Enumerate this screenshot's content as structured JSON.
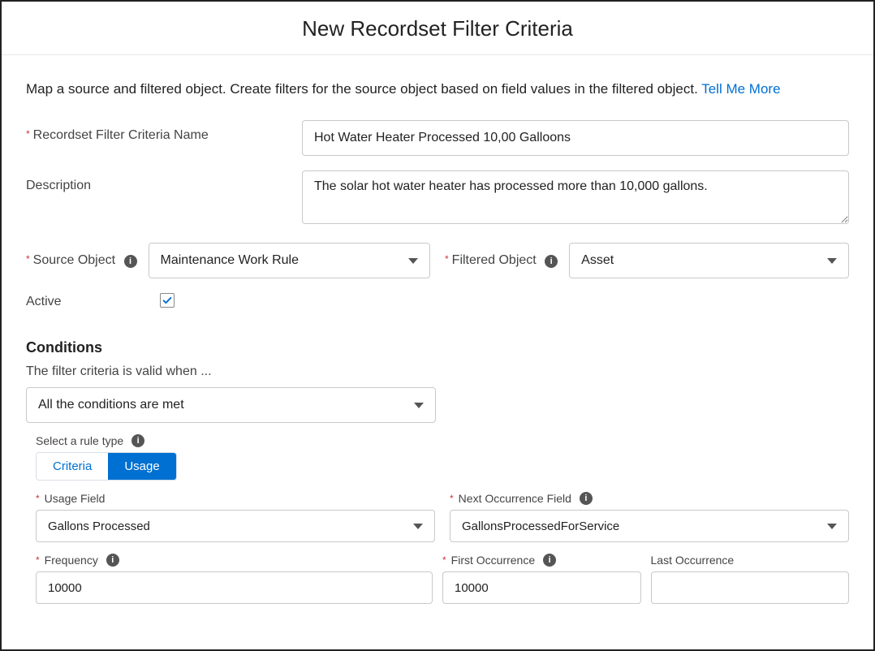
{
  "header": {
    "title": "New Recordset Filter Criteria"
  },
  "intro": {
    "text": "Map a source and filtered object. Create filters for the source object based on field values in the filtered object. ",
    "link": "Tell Me More"
  },
  "fields": {
    "name_label": "Recordset Filter Criteria Name",
    "name_value": "Hot Water Heater Processed 10,00 Galloons",
    "description_label": "Description",
    "description_value": "The solar hot water heater has processed more than 10,000 gallons.",
    "source_object_label": "Source Object",
    "source_object_value": "Maintenance Work Rule",
    "filtered_object_label": "Filtered Object",
    "filtered_object_value": "Asset",
    "active_label": "Active",
    "active_checked": true
  },
  "conditions": {
    "heading": "Conditions",
    "helper": "The filter criteria is valid when ...",
    "logic_value": "All the conditions are met",
    "rule_type_label": "Select a rule type",
    "tabs": {
      "criteria": "Criteria",
      "usage": "Usage",
      "active": "usage"
    },
    "usage_field_label": "Usage Field",
    "usage_field_value": "Gallons Processed",
    "next_occ_label": "Next Occurrence Field",
    "next_occ_value": "GallonsProcessedForService",
    "frequency_label": "Frequency",
    "frequency_value": "10000",
    "first_occ_label": "First Occurrence",
    "first_occ_value": "10000",
    "last_occ_label": "Last Occurrence",
    "last_occ_value": ""
  }
}
